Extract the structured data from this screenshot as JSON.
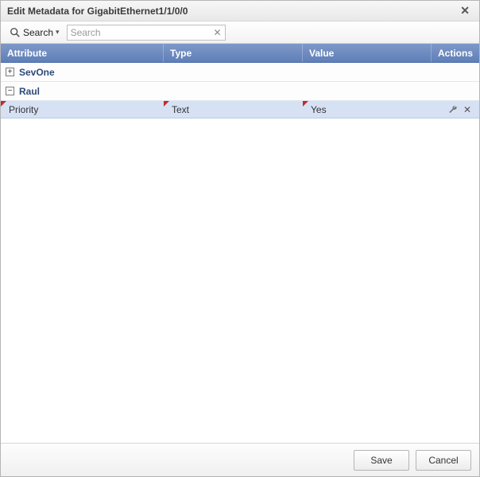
{
  "title": "Edit Metadata for GigabitEthernet1/1/0/0",
  "toolbar": {
    "search_label": "Search",
    "search_placeholder": "Search"
  },
  "columns": {
    "attribute": "Attribute",
    "type": "Type",
    "value": "Value",
    "actions": "Actions"
  },
  "groups": [
    {
      "name": "SevOne",
      "expanded": false,
      "rows": []
    },
    {
      "name": "Raul",
      "expanded": true,
      "rows": [
        {
          "attribute": "Priority",
          "type": "Text",
          "value": "Yes",
          "dirty": true
        }
      ]
    }
  ],
  "footer": {
    "save_label": "Save",
    "cancel_label": "Cancel"
  }
}
